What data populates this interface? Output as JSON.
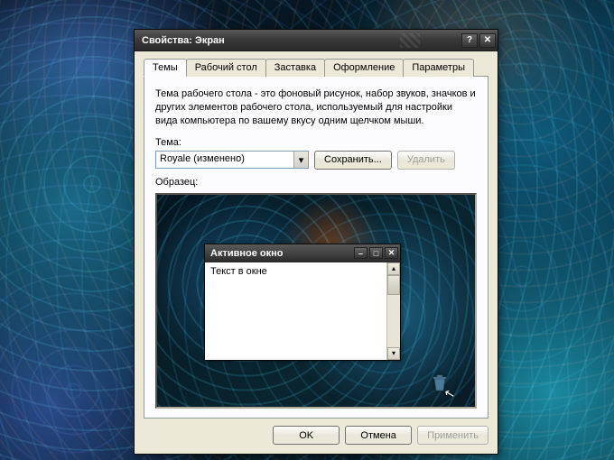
{
  "dialog": {
    "title": "Свойства: Экран",
    "tabs": [
      {
        "label": "Темы",
        "active": true
      },
      {
        "label": "Рабочий стол",
        "active": false
      },
      {
        "label": "Заставка",
        "active": false
      },
      {
        "label": "Оформление",
        "active": false
      },
      {
        "label": "Параметры",
        "active": false
      }
    ],
    "description": "Тема рабочего стола - это фоновый рисунок, набор звуков, значков и других элементов рабочего стола, используемый для настройки вида компьютера по вашему вкусу одним щелчком мыши.",
    "theme_label": "Тема:",
    "theme_value": "Royale (изменено)",
    "save_button": "Сохранить...",
    "delete_button": "Удалить",
    "sample_label": "Образец:",
    "sample_window": {
      "title": "Активное окно",
      "body_text": "Текст в окне"
    },
    "buttons": {
      "ok": "OK",
      "cancel": "Отмена",
      "apply": "Применить"
    }
  }
}
